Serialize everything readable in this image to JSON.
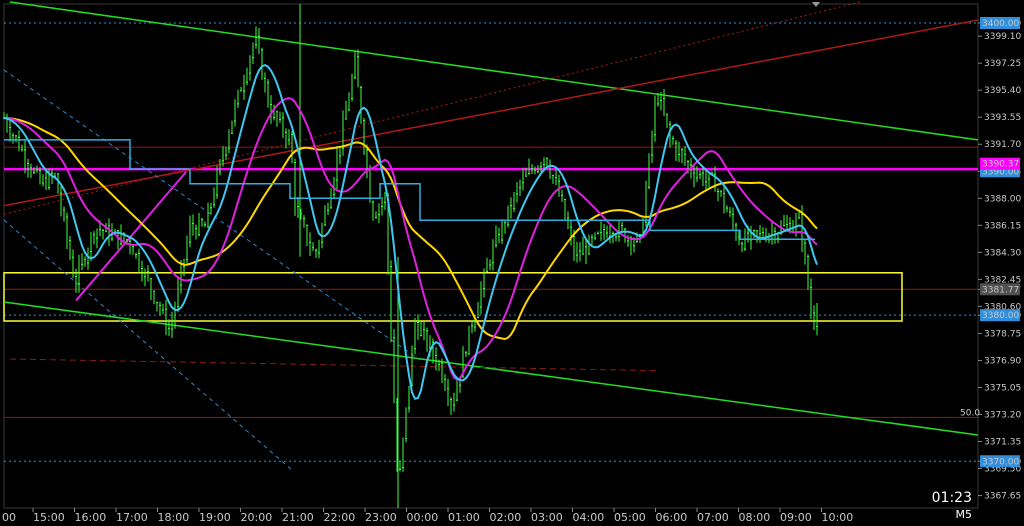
{
  "chart_data": {
    "type": "candlestick",
    "timeframe": "M5",
    "clock": "01:23",
    "y_range": [
      3366.8,
      3401.3
    ],
    "y_ticks": [
      "3400.00",
      "3399.10",
      "3397.25",
      "3395.40",
      "3393.55",
      "3391.70",
      "3389.85",
      "3388.00",
      "3386.15",
      "3384.30",
      "3382.45",
      "3381.77",
      "3380.60",
      "3380.00",
      "3378.75",
      "3376.90",
      "3375.05",
      "3373.20",
      "3371.35",
      "3370.00",
      "3369.50",
      "3367.65"
    ],
    "x_labels": [
      "15:00",
      "16:00",
      "17:00",
      "18:00",
      "19:00",
      "20:00",
      "21:00",
      "22:00",
      "23:00",
      "00:00",
      "01:00",
      "02:00",
      "03:00",
      "04:00",
      "05:00",
      "06:00",
      "07:00",
      "08:00",
      "09:00",
      "10:00"
    ],
    "x_label_head": "00",
    "price_tags": [
      {
        "value": 3400.0,
        "label": "3400.00",
        "color": "#2f8fdc"
      },
      {
        "value": 3389.85,
        "label": "3390.00",
        "color": "#2f8fdc"
      },
      {
        "value": 3390.37,
        "label": "3390.37",
        "color": "#ff00ff"
      },
      {
        "value": 3381.77,
        "label": "3381.77",
        "color": "#505050"
      },
      {
        "value": 3380.0,
        "label": "3380.00",
        "color": "#2f8fdc"
      },
      {
        "value": 3370.0,
        "label": "3370.00",
        "color": "#2f8fdc"
      }
    ],
    "fib_label": "50.0",
    "close_price": 3381.77,
    "ma_colors": {
      "yellow": "#ffd700",
      "magenta": "#e020e0",
      "cyan": "#3ec8f0",
      "candle": "#3cff3c"
    }
  }
}
